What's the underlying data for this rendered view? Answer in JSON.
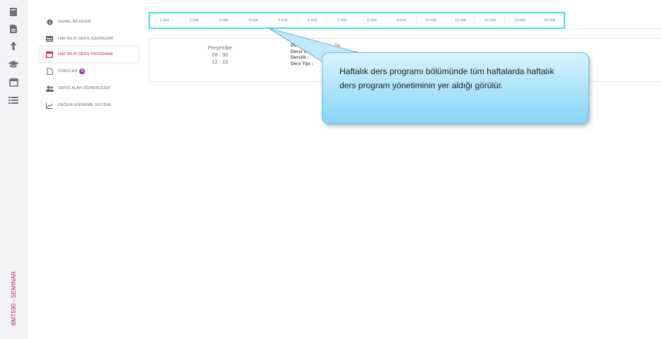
{
  "sidebar": {
    "icons": [
      "book-icon",
      "document-icon",
      "upload-arrow-icon",
      "graduation-cap-icon",
      "calendar-icon",
      "list-icon"
    ],
    "course_label": "BMT590 - SEMINAR"
  },
  "menu": {
    "items": [
      {
        "label": "GENEL BİLGİLER",
        "icon": "info-icon"
      },
      {
        "label": "HAFTALIK DERS İÇERİKLERİ",
        "icon": "table-icon"
      },
      {
        "label": "HAFTALIK DERS PROGRAMI",
        "icon": "calendar-icon"
      },
      {
        "label": "ÖDEVLER",
        "icon": "file-icon",
        "badge": "8"
      },
      {
        "label": "DERSİ ALAN ÖĞRENCİLER",
        "icon": "users-icon"
      },
      {
        "label": "DEĞERLENDİRME SİSTEMİ",
        "icon": "chart-icon"
      }
    ],
    "active_index": 2
  },
  "weeks": [
    "1.Haf",
    "2.Haf",
    "3.Haf",
    "4.Haf",
    "5.Haf",
    "6.Haf",
    "7.Haf",
    "8.Haf",
    "9.Haf",
    "10.Haf",
    "11.Haf",
    "12.Haf",
    "13.Haf",
    "14.Haf"
  ],
  "schedule": {
    "day": "Perşembe",
    "start": "08 : 30",
    "end": "12 : 15",
    "fields": [
      "Ders Adı :",
      "Dersi Veren :",
      "Derslik :",
      "Ders Tipi :"
    ],
    "course_name_partial": "Se"
  },
  "callout": {
    "text": "Haftalık ders programı bölümünde tüm haftalarda haftalık ders program yönetiminin yer aldığı görülür."
  },
  "colors": {
    "accent": "#c2185b",
    "badge": "#9c27b0",
    "highlight": "#3fe0f0",
    "callout": "#a9e3fb"
  }
}
